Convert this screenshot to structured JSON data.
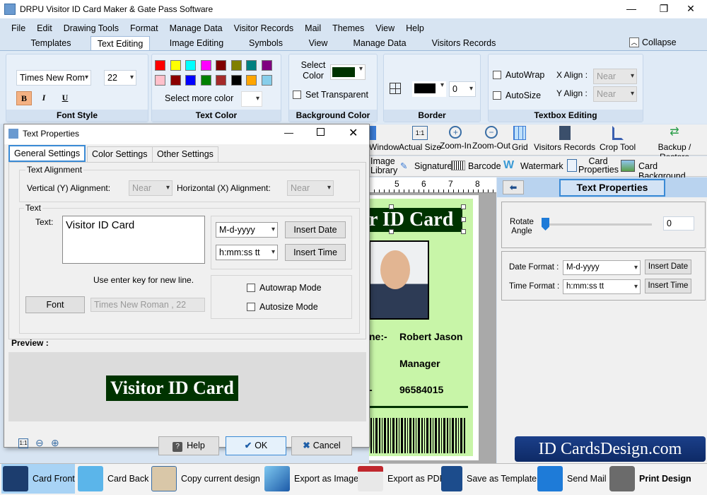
{
  "window": {
    "title": "DRPU Visitor ID Card Maker & Gate Pass Software",
    "min": "—",
    "max": "❐",
    "close": "✕"
  },
  "menu": [
    "File",
    "Edit",
    "Drawing Tools",
    "Format",
    "Manage Data",
    "Visitor Records",
    "Mail",
    "Themes",
    "View",
    "Help"
  ],
  "ribbon_tabs": [
    "Templates",
    "Text Editing",
    "Image Editing",
    "Symbols",
    "View",
    "Manage Data",
    "Visitors Records"
  ],
  "active_ribbon_tab": "Text Editing",
  "collapse": "Collapse",
  "font_style": {
    "font": "Times New Rom",
    "size": "22",
    "bold": "B",
    "italic": "I",
    "underline": "U",
    "label": "Font Style"
  },
  "text_color": {
    "swatches": [
      "#ff0000",
      "#ffff00",
      "#00ffff",
      "#ff00ff",
      "#800000",
      "#808000",
      "#008080",
      "#800080",
      "#ffc0cb",
      "#8b0000",
      "#0000ff",
      "#008000",
      "#a52a2a",
      "#000000",
      "#ffa500",
      "#87ceeb"
    ],
    "more": "Select more color",
    "label": "Text Color"
  },
  "background_color": {
    "select": "Select Color",
    "value": "#003300",
    "transparent": "Set Transparent",
    "label": "Background Color"
  },
  "border": {
    "width": "0",
    "color": "#000000",
    "label": "Border"
  },
  "textbox": {
    "autowrap": "AutoWrap",
    "autosize": "AutoSize",
    "x_align_label": "X Align :",
    "y_align_label": "Y Align :",
    "x_align": "Near",
    "y_align": "Near",
    "label": "Textbox Editing"
  },
  "dialog": {
    "title": "Text Properties",
    "tabs": [
      "General Settings",
      "Color Settings",
      "Other Settings"
    ],
    "alignment": {
      "legend": "Text Alignment",
      "vertical_label": "Vertical (Y) Alignment:",
      "vertical": "Near",
      "horizontal_label": "Horizontal (X) Alignment:",
      "horizontal": "Near"
    },
    "text": {
      "legend": "Text",
      "label": "Text:",
      "value": "Visitor ID Card",
      "hint": "Use enter key for new line.",
      "date_format": "M-d-yyyy",
      "time_format": "h:mm:ss tt",
      "insert_date": "Insert Date",
      "insert_time": "Insert Time",
      "autowrap": "Autowrap Mode",
      "autosize": "Autosize Mode",
      "font_button": "Font",
      "font_value": "Times New Roman , 22"
    },
    "preview_label": "Preview :",
    "preview_text": "Visitor ID Card",
    "help": "Help",
    "ok": "OK",
    "cancel": "Cancel"
  },
  "toolbar": [
    "Window",
    "Actual Size",
    "Zoom-In",
    "Zoom-Out",
    "Grid",
    "Visitors Records",
    "Crop Tool",
    "Backup / Restore"
  ],
  "toolbar2": [
    "Image Library",
    "Signature",
    "Barcode",
    "Watermark",
    "Card Properties",
    "Card Background"
  ],
  "ruler": [
    "5",
    "6",
    "7",
    "8"
  ],
  "card": {
    "title": "r ID Card",
    "name_label": "ne:-",
    "name": "Robert Jason",
    "designation": "Manager",
    "id_label": "-",
    "phone": "96584015"
  },
  "right_panel": {
    "title": "Text Properties",
    "rotate_label": "Rotate Angle",
    "rotate": "0",
    "rotate_fraction": 0,
    "date_label": "Date Format :",
    "date": "M-d-yyyy",
    "time_label": "Time Format :",
    "time": "h:mm:ss tt",
    "insert_date": "Insert Date",
    "insert_time": "Insert Time"
  },
  "banner": "ID CardsDesign.com",
  "bottom": [
    "Card Front",
    "Card Back",
    "Copy current design",
    "Export as Image",
    "Export as PDF",
    "Save as Template",
    "Send Mail",
    "Print Design"
  ]
}
